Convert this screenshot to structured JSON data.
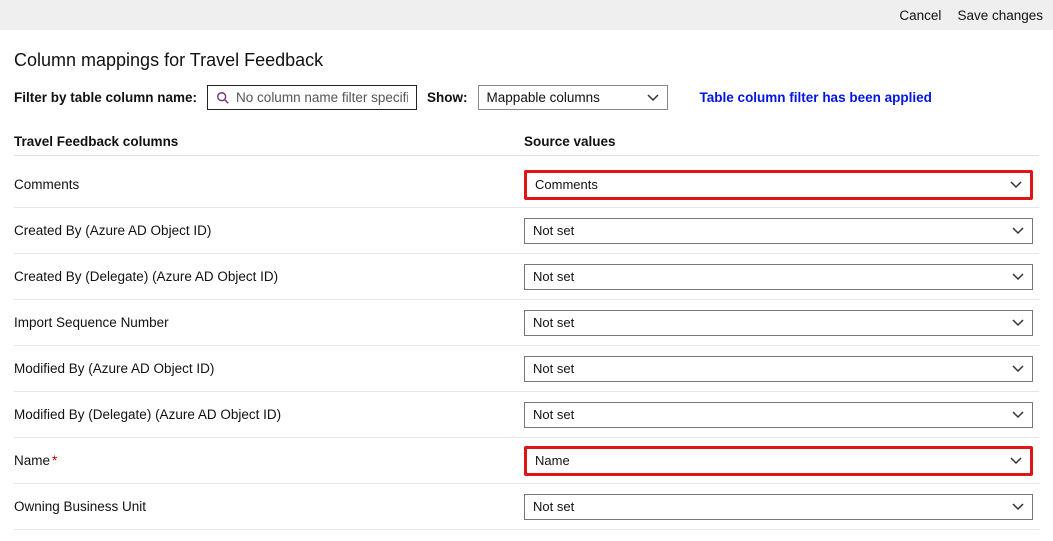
{
  "toolbar": {
    "cancel": "Cancel",
    "save": "Save changes"
  },
  "page": {
    "title": "Column mappings for Travel Feedback",
    "filter_label": "Filter by table column name:",
    "filter_placeholder": "No column name filter specified",
    "show_label": "Show:",
    "show_value": "Mappable columns",
    "status": "Table column filter has been applied"
  },
  "table": {
    "left_header": "Travel Feedback columns",
    "right_header": "Source values",
    "rows": [
      {
        "label": "Comments",
        "required": false,
        "source": "Comments",
        "highlight": true
      },
      {
        "label": "Created By (Azure AD Object ID)",
        "required": false,
        "source": "Not set",
        "highlight": false
      },
      {
        "label": "Created By (Delegate) (Azure AD Object ID)",
        "required": false,
        "source": "Not set",
        "highlight": false
      },
      {
        "label": "Import Sequence Number",
        "required": false,
        "source": "Not set",
        "highlight": false
      },
      {
        "label": "Modified By (Azure AD Object ID)",
        "required": false,
        "source": "Not set",
        "highlight": false
      },
      {
        "label": "Modified By (Delegate) (Azure AD Object ID)",
        "required": false,
        "source": "Not set",
        "highlight": false
      },
      {
        "label": "Name",
        "required": true,
        "source": "Name",
        "highlight": true
      },
      {
        "label": "Owning Business Unit",
        "required": false,
        "source": "Not set",
        "highlight": false
      }
    ]
  }
}
